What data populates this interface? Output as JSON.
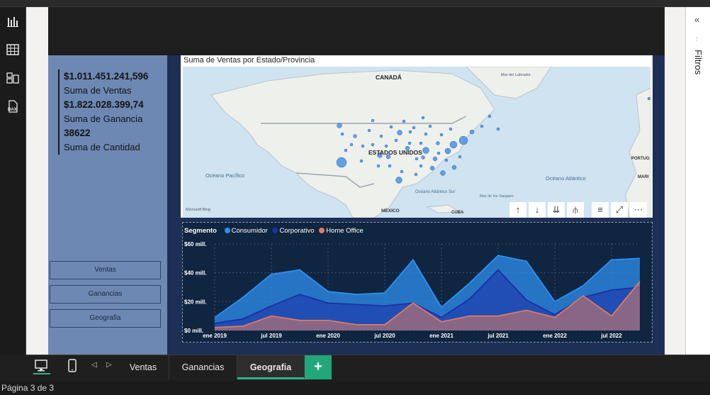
{
  "kpis": [
    {
      "value": "$1.011.451.241,596",
      "label": "Suma de Ventas"
    },
    {
      "value": "$1.822.028.399,74",
      "label": "Suma de Ganancia"
    },
    {
      "value": "38622",
      "label": "Suma de Cantidad"
    }
  ],
  "nav_buttons": [
    "Ventas",
    "Ganancias",
    "Geografia"
  ],
  "right_pane": {
    "title": "Filtros"
  },
  "map": {
    "title": "Suma de Ventas por Estado/Provincia",
    "labels": {
      "canada": "CANADÁ",
      "labrador": "Mar del Labrador",
      "usa": "ESTADOS UNIDOS",
      "pacifico": "Océano Pacífico",
      "atlantico": "Océano Atlántico",
      "atlantico_sur": "Océano Atlántico Sur",
      "sargazo": "Mar de los Sargazo",
      "mexico": "MÉXICO",
      "cuba": "CUBA",
      "portugal": "PORTUG",
      "mar": "MARI",
      "bing": "Microsoft Bing"
    },
    "controls": [
      "arrow-up-icon",
      "arrow-down-icon",
      "double-arrow-down-icon",
      "hierarchy-icon",
      "filter-icon",
      "focus-mode-icon",
      "more-options-icon"
    ]
  },
  "tabs": [
    "Ventas",
    "Ganancias",
    "Geografia"
  ],
  "active_tab": "Geografia",
  "status": "Página 3 de 3",
  "chart_data": {
    "type": "area",
    "legend_title": "Segmento",
    "x_ticks": [
      "ene 2019",
      "jul 2019",
      "ene 2020",
      "jul 2020",
      "ene 2021",
      "jul 2021",
      "ene 2022",
      "jul 2022"
    ],
    "y_ticks": [
      "$0 mill.",
      "$20 mill.",
      "$40 mill.",
      "$60 mill."
    ],
    "ylim": [
      0,
      60
    ],
    "series": [
      {
        "name": "Consumidor",
        "color": "#2f8ff0",
        "values": [
          9,
          23,
          39,
          42,
          27,
          25,
          26,
          49,
          16,
          33,
          52,
          48,
          20,
          31,
          49,
          50
        ]
      },
      {
        "name": "Corporativo",
        "color": "#1b2fa8",
        "values": [
          5,
          8,
          17,
          25,
          19,
          18,
          17,
          19,
          9,
          22,
          42,
          21,
          11,
          23,
          28,
          30
        ]
      },
      {
        "name": "Home Office",
        "color": "#e07a60",
        "values": [
          2,
          3,
          10,
          7,
          7,
          4,
          4,
          19,
          6,
          10,
          10,
          14,
          9,
          24,
          10,
          34
        ]
      }
    ]
  }
}
